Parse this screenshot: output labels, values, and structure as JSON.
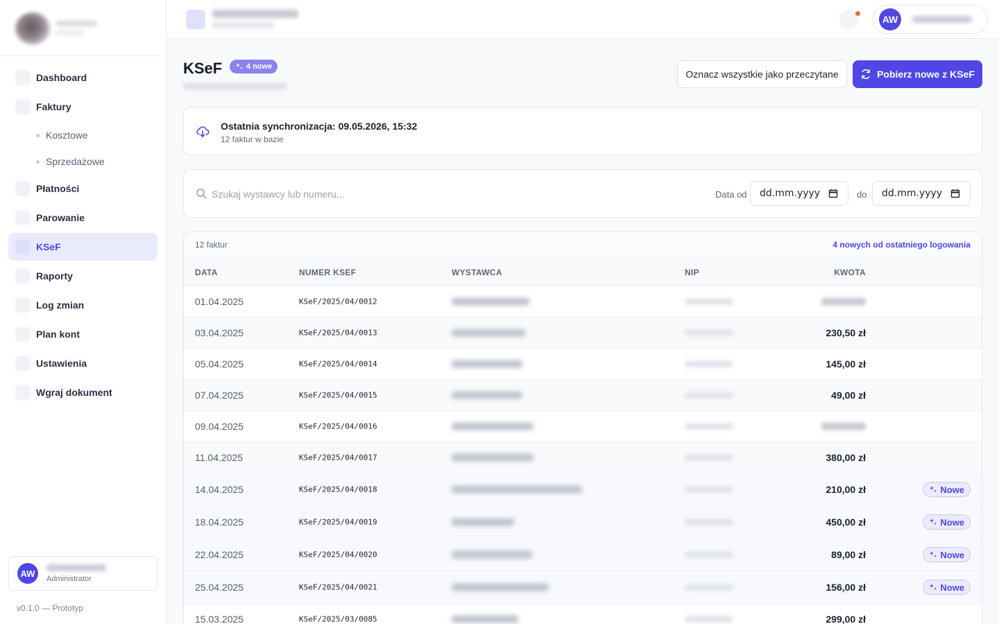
{
  "sidebar": {
    "items": [
      {
        "label": "Dashboard"
      },
      {
        "label": "Faktury"
      },
      {
        "label": "Płatności"
      },
      {
        "label": "Parowanie"
      },
      {
        "label": "KSeF"
      },
      {
        "label": "Raporty"
      },
      {
        "label": "Log zmian"
      },
      {
        "label": "Plan kont"
      },
      {
        "label": "Ustawienia"
      },
      {
        "label": "Wgraj dokument"
      }
    ],
    "sub_items": [
      {
        "label": "Kosztowe"
      },
      {
        "label": "Sprzedażowe"
      }
    ],
    "user": {
      "initials": "AW",
      "role": "Administrator"
    },
    "version": "v0.1.0 — Prototyp"
  },
  "topbar": {
    "user_initials": "AW"
  },
  "page": {
    "title": "KSeF",
    "badge": "4 nowe",
    "mark_all_read": "Oznacz wszystkie jako przeczytane",
    "fetch_new": "Pobierz nowe z KSeF"
  },
  "sync": {
    "title": "Ostatnia synchronizacja: 09.05.2026, 15:32",
    "subtitle": "12 faktur w bazie"
  },
  "filters": {
    "search_placeholder": "Szukaj wystawcy lub numeru...",
    "date_from_label": "Data od",
    "date_to_label": "do",
    "date_from_value": "dd.mm.yyyy",
    "date_to_value": "dd.mm.yyyy"
  },
  "table": {
    "count_label": "12 faktur",
    "new_since_label": "4 nowych od ostatniego logowania",
    "columns": [
      "DATA",
      "NUMER KSEF",
      "WYSTAWCA",
      "NIP",
      "KWOTA"
    ],
    "new_label": "Nowe",
    "rows": [
      {
        "date": "01.04.2025",
        "number": "KSeF/2025/04/0012",
        "amount": "",
        "new": false
      },
      {
        "date": "03.04.2025",
        "number": "KSeF/2025/04/0013",
        "amount": "230,50 zł",
        "new": false
      },
      {
        "date": "05.04.2025",
        "number": "KSeF/2025/04/0014",
        "amount": "145,00 zł",
        "new": false
      },
      {
        "date": "07.04.2025",
        "number": "KSeF/2025/04/0015",
        "amount": "49,00 zł",
        "new": false
      },
      {
        "date": "09.04.2025",
        "number": "KSeF/2025/04/0016",
        "amount": "",
        "new": false
      },
      {
        "date": "11.04.2025",
        "number": "KSeF/2025/04/0017",
        "amount": "380,00 zł",
        "new": false
      },
      {
        "date": "14.04.2025",
        "number": "KSeF/2025/04/0018",
        "amount": "210,00 zł",
        "new": true
      },
      {
        "date": "18.04.2025",
        "number": "KSeF/2025/04/0019",
        "amount": "450,00 zł",
        "new": true
      },
      {
        "date": "22.04.2025",
        "number": "KSeF/2025/04/0020",
        "amount": "89,00 zł",
        "new": true
      },
      {
        "date": "25.04.2025",
        "number": "KSeF/2025/04/0021",
        "amount": "156,00 zł",
        "new": true
      },
      {
        "date": "15.03.2025",
        "number": "KSeF/2025/03/0085",
        "amount": "299,00 zł",
        "new": false
      }
    ]
  },
  "colors": {
    "accent": "#4f46e5",
    "badge": "#8b82ee",
    "notification_dot": "#e0703d"
  }
}
